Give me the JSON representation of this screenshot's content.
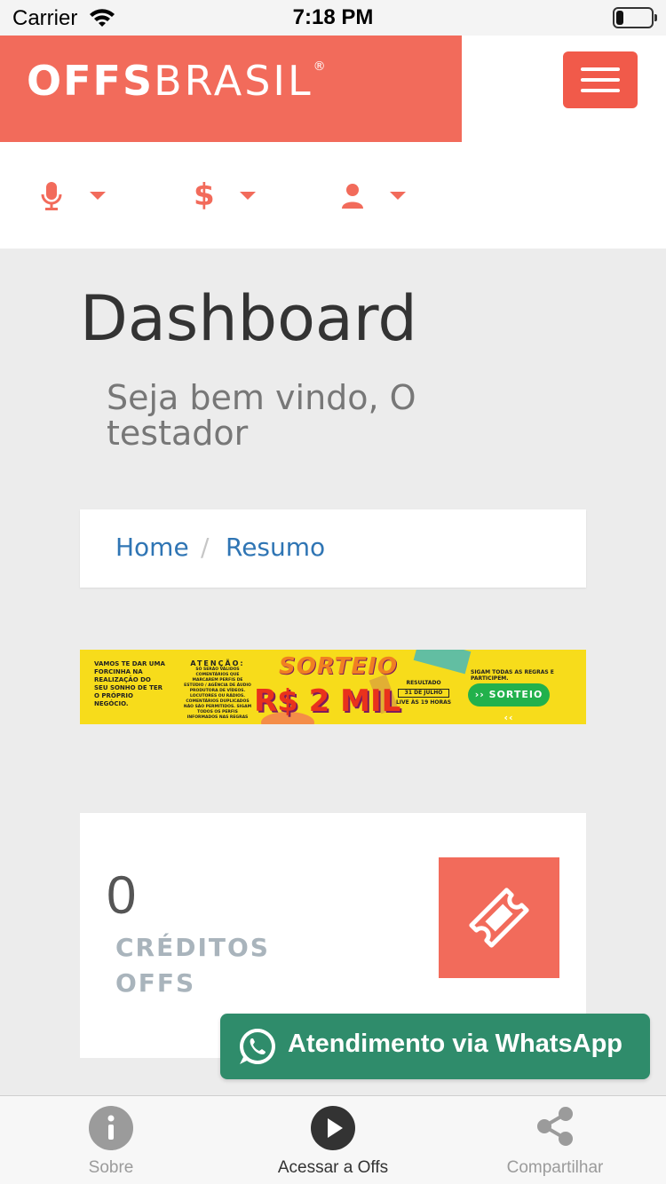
{
  "status_bar": {
    "carrier": "Carrier",
    "time": "7:18 PM",
    "wifi_icon": "wifi-icon",
    "battery_icon": "battery-icon"
  },
  "header": {
    "logo_main": "OFFS",
    "logo_sub": "BRASIL",
    "logo_reg": "®",
    "menu_icon": "hamburger-menu-icon",
    "brand_color": "#f26b5b",
    "toolbar_items": [
      {
        "icon": "microphone-icon"
      },
      {
        "icon": "dollar-icon"
      },
      {
        "icon": "user-icon"
      }
    ]
  },
  "main": {
    "title": "Dashboard",
    "welcome": "Seja bem vindo, O testador",
    "breadcrumb": {
      "home": "Home",
      "separator": "/",
      "current": "Resumo"
    },
    "banner": {
      "left_text": "VAMOS TE DAR UMA FORCINHA NA REALIZAÇÃO DO SEU SONHO DE TER O PRÓPRIO NEGÓCIO.",
      "attention_title": "ATENÇÃO:",
      "attention_text": "SÓ SERÃO VÁLIDOS COMENTÁRIOS QUE MARCAREM PERFIS DE ESTÚDIO / AGÊNCIA DE ÁUDIO PRODUTORA DE VÍDEOS. LOCUTORES OU RÁDIOS. COMENTÁRIOS DUPLICADOS NÃO SÃO PERMITIDOS. SIGAM TODOS OS PERFIS INFORMADOS NAS REGRAS",
      "sorteio_title": "SORTEIO",
      "prize": "R$ 2 MIL",
      "result_label": "RESULTADO",
      "result_date": "31 DE JULHO",
      "result_time": "LIVE ÀS 19 HORAS",
      "rules_text": "SIGAM TODAS AS REGRAS E PARTICIPEM.",
      "button_label": "›› SORTEIO ‹‹"
    },
    "credits": {
      "value": "0",
      "label": "CRÉDITOS OFFS",
      "icon": "ticket-icon"
    }
  },
  "whatsapp": {
    "label": "Atendimento via WhatsApp",
    "icon": "whatsapp-icon",
    "color": "#2f8c6b"
  },
  "tab_bar": {
    "tabs": [
      {
        "label": "Sobre",
        "icon": "info-icon"
      },
      {
        "label": "Acessar a Offs",
        "icon": "play-icon"
      },
      {
        "label": "Compartilhar",
        "icon": "share-icon"
      }
    ]
  }
}
